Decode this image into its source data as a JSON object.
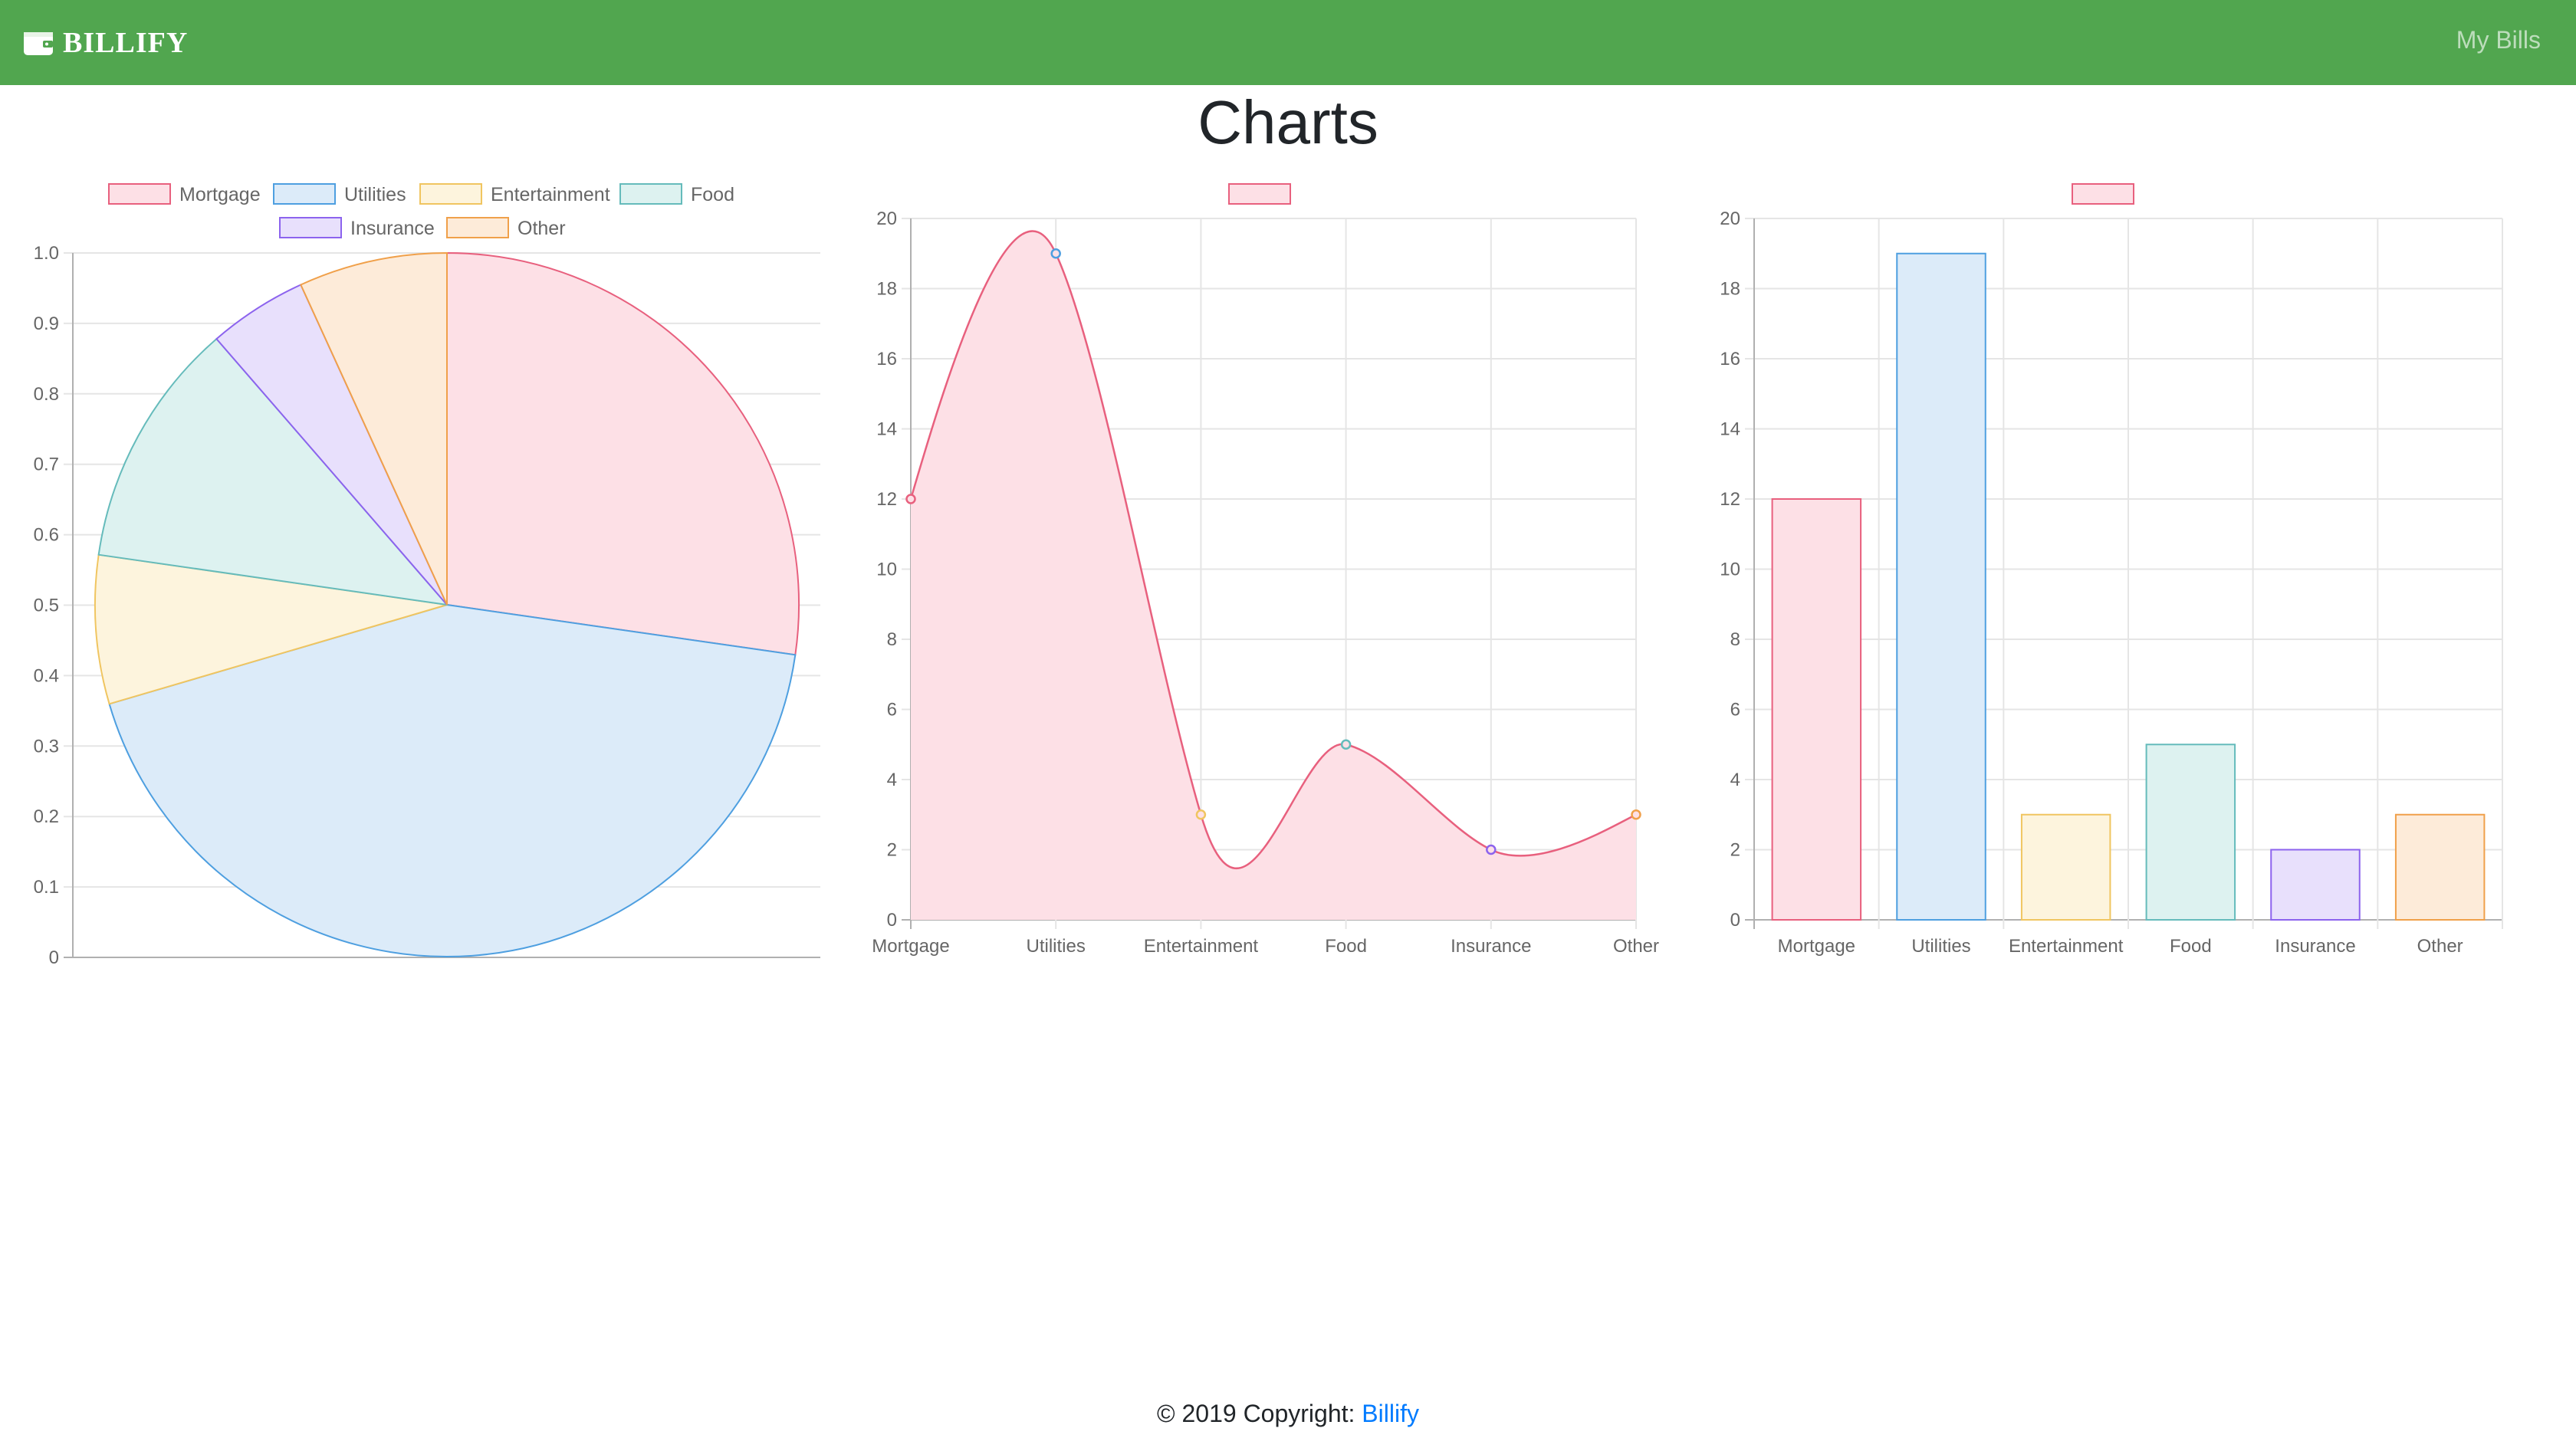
{
  "navbar": {
    "brand": "BILLIFY",
    "brand_icon": "wallet-icon",
    "link_my_bills": "My Bills",
    "background": "#51a64f"
  },
  "page": {
    "title": "Charts"
  },
  "footer": {
    "copyright": "© 2019 Copyright: ",
    "link": "Billify"
  },
  "chart_data": [
    {
      "type": "pie",
      "categories": [
        "Mortgage",
        "Utilities",
        "Entertainment",
        "Food",
        "Insurance",
        "Other"
      ],
      "values": [
        12,
        19,
        3,
        5,
        2,
        3
      ],
      "legend_position": "top",
      "ylim": [
        0,
        1.0
      ],
      "yticks": [
        "0",
        "0.1",
        "0.2",
        "0.3",
        "0.4",
        "0.5",
        "0.6",
        "0.7",
        "0.8",
        "0.9",
        "1.0"
      ],
      "grid": true,
      "colors": {
        "fill": [
          "#fde0e6",
          "#dcebf9",
          "#fdf4dd",
          "#ddf2f0",
          "#e8e0fc",
          "#fdebd9"
        ],
        "border": [
          "#e8607e",
          "#4e9fe0",
          "#f0c560",
          "#65bbbb",
          "#8c63ee",
          "#f0a04a"
        ]
      }
    },
    {
      "type": "line",
      "categories": [
        "Mortgage",
        "Utilities",
        "Entertainment",
        "Food",
        "Insurance",
        "Other"
      ],
      "series": [
        {
          "values": [
            12,
            19,
            3,
            5,
            2,
            3
          ]
        }
      ],
      "ylim": [
        0,
        20
      ],
      "yticks": [
        "0",
        "2",
        "4",
        "6",
        "8",
        "10",
        "12",
        "14",
        "16",
        "18",
        "20"
      ],
      "fill": true,
      "smooth": true,
      "grid": true,
      "legend_position": "top",
      "colors": {
        "fill": "#fde0e6",
        "line": "#e8607e"
      }
    },
    {
      "type": "bar",
      "categories": [
        "Mortgage",
        "Utilities",
        "Entertainment",
        "Food",
        "Insurance",
        "Other"
      ],
      "values": [
        12,
        19,
        3,
        5,
        2,
        3
      ],
      "ylim": [
        0,
        20
      ],
      "yticks": [
        "0",
        "2",
        "4",
        "6",
        "8",
        "10",
        "12",
        "14",
        "16",
        "18",
        "20"
      ],
      "grid": true,
      "legend_position": "top",
      "colors": {
        "fill": [
          "#fde0e6",
          "#dcebf9",
          "#fdf4dd",
          "#ddf2f0",
          "#e8e0fc",
          "#fdebd9"
        ],
        "border": [
          "#e8607e",
          "#4e9fe0",
          "#f0c560",
          "#65bbbb",
          "#8c63ee",
          "#f0a04a"
        ]
      }
    }
  ]
}
